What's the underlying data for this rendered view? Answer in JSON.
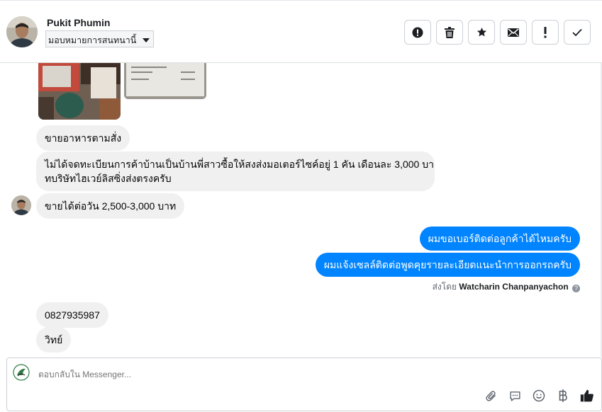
{
  "header": {
    "contact_name": "Pukit Phumin",
    "assign_label": "มอบหมายการสนทนานี้"
  },
  "actions": [
    {
      "name": "report-spam-button",
      "icon": "alert-circle-icon"
    },
    {
      "name": "delete-button",
      "icon": "trash-icon"
    },
    {
      "name": "star-button",
      "icon": "star-icon"
    },
    {
      "name": "mark-unread-button",
      "icon": "envelope-icon"
    },
    {
      "name": "follow-up-button",
      "icon": "exclamation-icon"
    },
    {
      "name": "mark-done-button",
      "icon": "check-icon"
    }
  ],
  "messages": {
    "incoming_1": "ขายอาหารตามสั่ง",
    "incoming_2_line1": "ไม่ได้จดทะเบียนการค้าบ้านเป็นบ้านพี่สาวซื้อให้สงส่งมอเตอร์ไซค์อยู่ 1 คัน เดือนละ 3,000 บา",
    "incoming_2_line2": "ทบริษัทไฮเวย์ลิสซิ่งส่งตรงครับ",
    "incoming_3": "ขายได้ต่อวัน 2,500-3,000 บาท",
    "outgoing_1": "ผมขอเบอร์ติดต่อลูกค้าได้ไหมครับ",
    "outgoing_2": "ผมแจ้งเซลล์ติดต่อพูดคุยรายละเอียดแนะนำการออกรถครับ",
    "sent_by_prefix": "ส่งโดย",
    "sent_by_name": "Watcharin Chanpanyachon",
    "incoming_4": "0827935987",
    "incoming_5": "วิทย์"
  },
  "composer": {
    "placeholder": "ตอบกลับใน Messenger..."
  },
  "colors": {
    "outgoing_bubble": "#0084ff",
    "incoming_bubble": "#f0f0f0"
  }
}
